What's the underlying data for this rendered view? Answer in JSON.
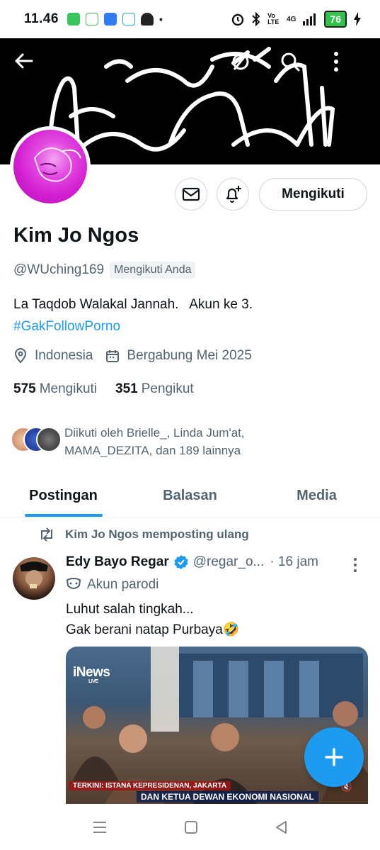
{
  "status_bar": {
    "time": "11.46",
    "battery": "76",
    "network_label": "4G",
    "volte": "Vo LTE"
  },
  "profile": {
    "name": "Kim Jo Ngos",
    "handle": "@WUching169",
    "follows_you_label": "Mengikuti Anda",
    "bio_line": "La Taqdob Walakal Jannah.   Akun ke 3.",
    "bio_hashtag": "#GakFollowPorno",
    "location": "Indonesia",
    "joined": "Bergabung Mei 2025",
    "following_count": "575",
    "following_label": "Mengikuti",
    "followers_count": "351",
    "followers_label": "Pengikut",
    "followed_by_text": "Diikuti oleh Brielle_, Linda Jum'at, MAMA_DEZITA, dan 189 lainnya",
    "follow_button_label": "Mengikuti"
  },
  "tabs": [
    {
      "label": "Postingan",
      "active": true
    },
    {
      "label": "Balasan",
      "active": false
    },
    {
      "label": "Media",
      "active": false
    }
  ],
  "post": {
    "repost_label": "Kim Jo Ngos memposting ulang",
    "author_name": "Edy Bayo Regar",
    "author_handle": "@regar_o...",
    "time": "· 16 jam",
    "parody_label": "Akun parodi",
    "text_line1": "Luhut salah tingkah...",
    "text_line2": "Gak berani natap Purbaya🤣",
    "media_logo": "iNews",
    "media_logo_sub": "LIVE",
    "media_ticker1": "TERKINI: ISTANA KEPRESIDENAN, JAKARTA",
    "media_ticker2": "DAN KETUA DEWAN EKONOMI NASIONAL"
  },
  "colors": {
    "accent": "#1d9bf0",
    "text_primary": "#0f1419",
    "text_secondary": "#536471",
    "border": "#cfd9de"
  },
  "icons": {
    "back": "arrow-left-icon",
    "hide": "eye-slash-icon",
    "search": "search-icon",
    "more": "more-vertical-icon",
    "message": "mail-icon",
    "notify": "bell-plus-icon",
    "location": "location-pin-icon",
    "calendar": "calendar-icon",
    "repost": "repost-icon",
    "verified": "verified-badge-icon",
    "parody": "mask-icon",
    "compose": "plus-icon"
  }
}
